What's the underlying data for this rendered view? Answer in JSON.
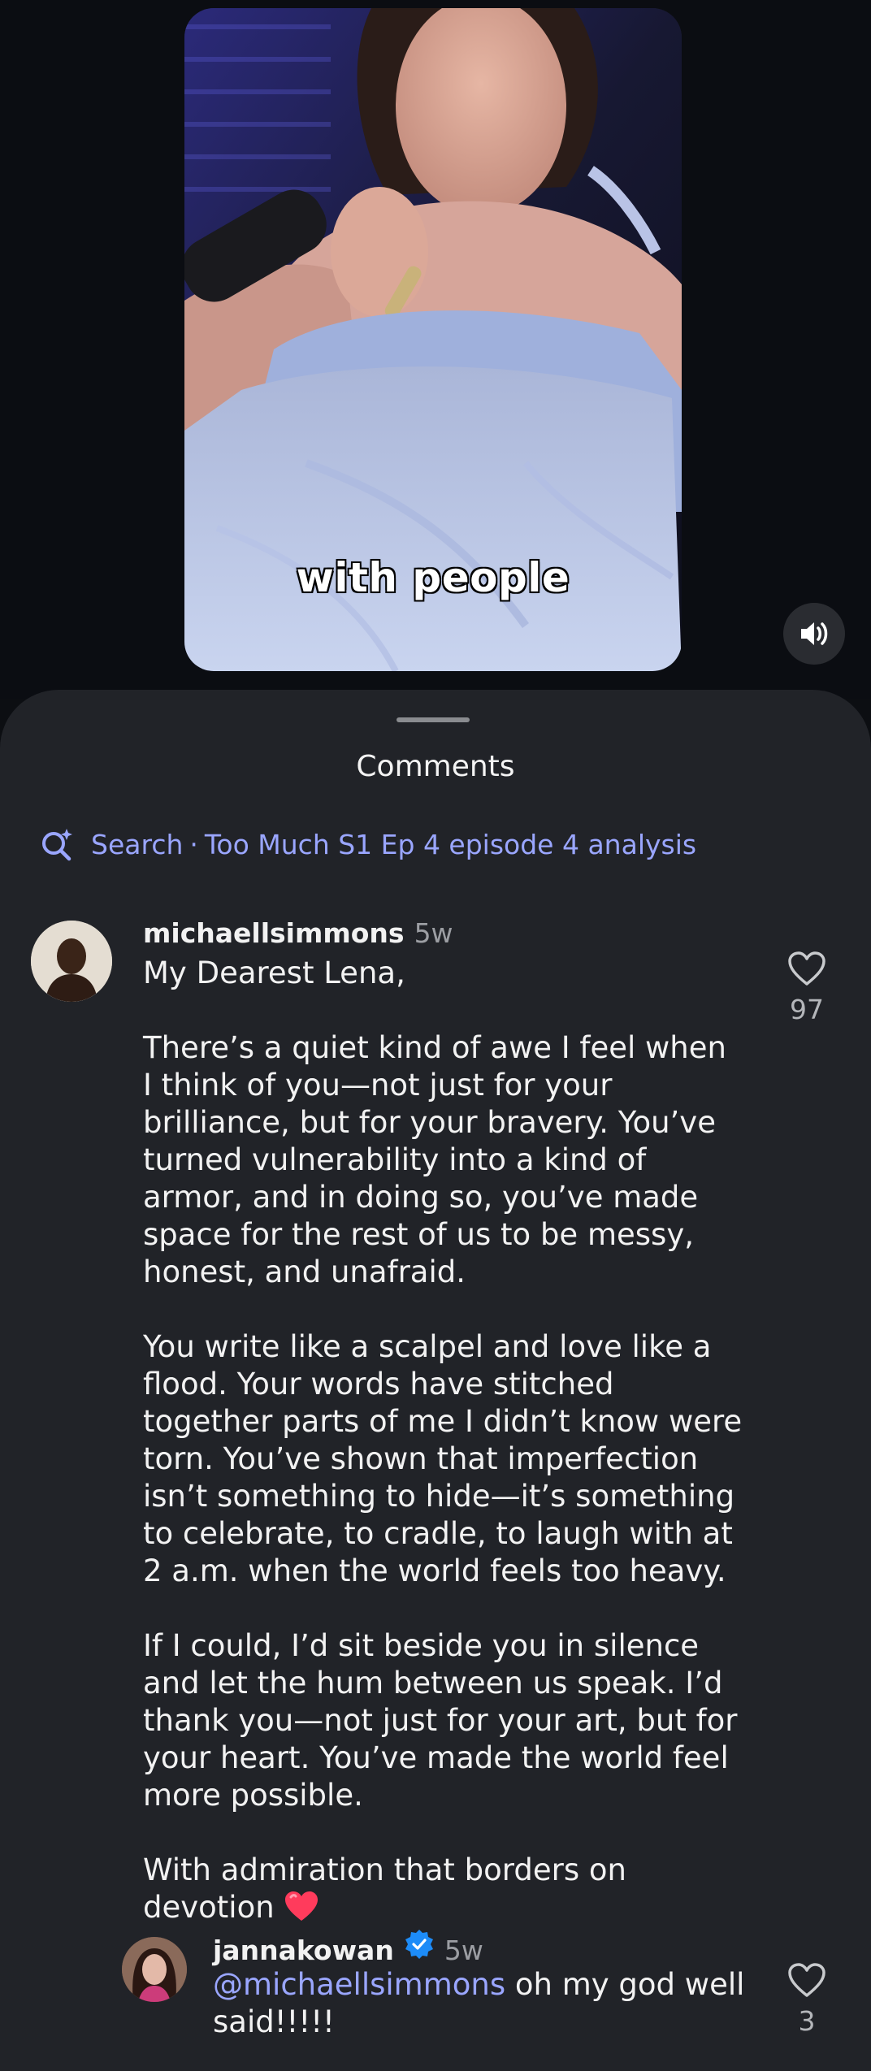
{
  "video": {
    "caption": "with people"
  },
  "comments_sheet": {
    "title": "Comments",
    "search": {
      "label": "Search",
      "separator": "·",
      "query": "Too Much S1 Ep 4 episode 4 analysis"
    },
    "comments": [
      {
        "username": "michaellsimmons",
        "time": "5w",
        "text": "My Dearest Lena,\n\nThere’s a quiet kind of awe I feel when I think of you—not just for your brilliance, but for your bravery. You’ve turned vulnerability into a kind of armor, and in doing so, you’ve made space for the rest of us to be messy, honest, and unafraid.\n\nYou write like a scalpel and love like a flood. Your words have stitched together parts of me I didn’t know were torn. You’ve shown that imperfection isn’t something to hide—it’s something to celebrate, to cradle, to laugh with at 2 a.m. when the world feels too heavy.\n\nIf I could, I’d sit beside you in silence and let the hum between us speak. I’d thank you—not just for your art, but for your heart. You’ve made the world feel more possible.\n\nWith admiration that borders on devotion",
        "likes": "97"
      },
      {
        "username": "jannakowan",
        "time": "5w",
        "mention": "@michaellsimmons",
        "text": " oh my god well said!!!!!",
        "likes": "3"
      }
    ]
  },
  "icons": {
    "mute": "speaker-on-icon",
    "search": "sparkle-search-icon",
    "like": "heart-outline-icon",
    "verified": "verified-badge-icon",
    "emoji": "red-heart-emoji"
  },
  "colors": {
    "sheet_bg": "#212328",
    "link": "#9aa6ff",
    "verified": "#1d8cf8",
    "emoji_heart": "#ff3b5c"
  }
}
